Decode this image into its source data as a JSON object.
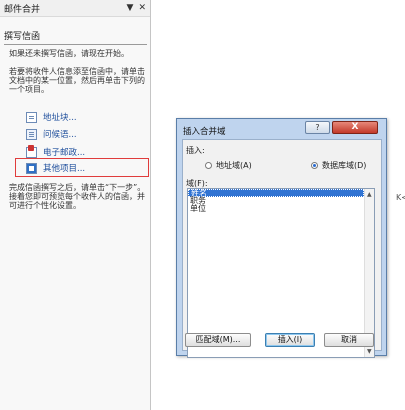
{
  "pane": {
    "title": "邮件合并",
    "dropdown_glyph": "▼",
    "close_glyph": "✕",
    "section_title": "撰写信函",
    "para1": "如果还未撰写信函，请现在开始。",
    "para2": "若要将收件人信息添至信函中，请单击文档中的某一位置，然后再单击下列的一个项目。",
    "items": [
      {
        "label": "地址块...",
        "icon": "address-block-icon"
      },
      {
        "label": "问候语...",
        "icon": "greeting-line-icon"
      },
      {
        "label": "电子邮政...",
        "icon": "electronic-postage-icon"
      },
      {
        "label": "其他项目...",
        "icon": "more-items-icon"
      }
    ],
    "para3": "完成信函撰写之后，请单击“下一步”。接着您即可预览每个收件人的信函，并可进行个性化设置。"
  },
  "dialog": {
    "title": "插入合并域",
    "help_glyph": "?",
    "close_glyph": "X",
    "insert_label": "插入:",
    "radio_address": "地址域(A)",
    "radio_database": "数据库域(D)",
    "fields_label": "域(F):",
    "fields": [
      "姓名",
      "职务",
      "单位"
    ],
    "selected_field": "姓名",
    "btn_match": "匹配域(M)...",
    "btn_insert": "插入(I)",
    "btn_cancel": "取消"
  },
  "colors": {
    "highlight": "#e03c3c",
    "selection": "#3073d3",
    "link": "#1e4e9c"
  }
}
